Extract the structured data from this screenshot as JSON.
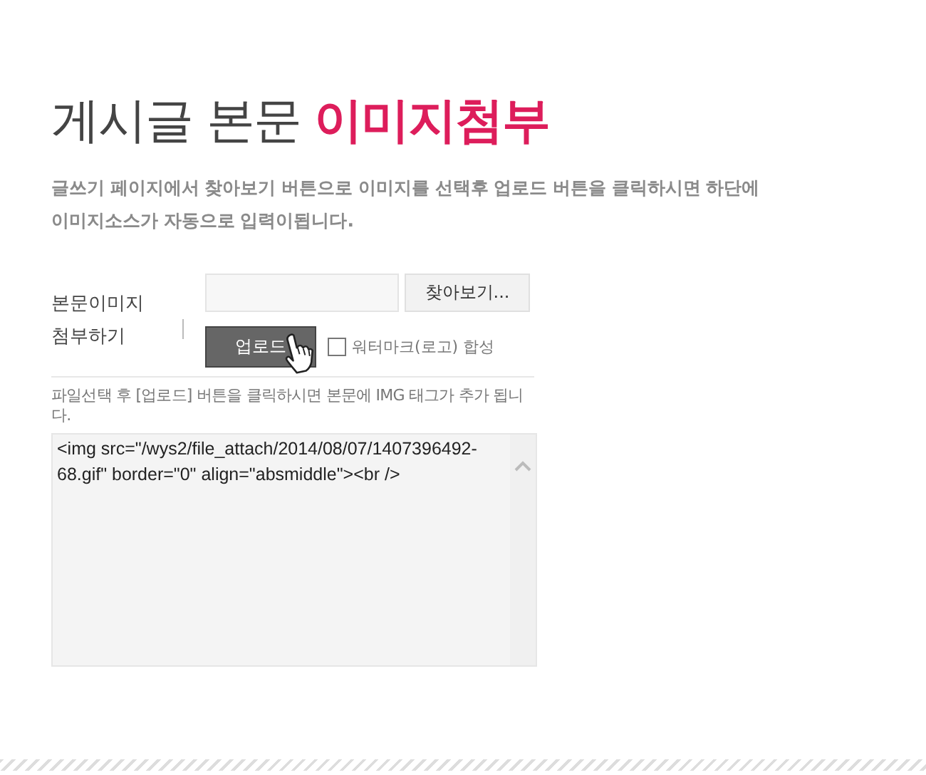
{
  "title": {
    "plain": "게시글 본문",
    "accent": "이미지첨부"
  },
  "description": "글쓰기 페이지에서 찾아보기 버튼으로 이미지를 선택후 업로드 버튼을 클릭하시면 하단에 이미지소스가 자동으로 입력이됩니다.",
  "form": {
    "label": "본문이미지 첨부하기",
    "browse_button": "찾아보기...",
    "upload_button": "업로드",
    "watermark": {
      "label": "워터마크(로고) 합성",
      "checked": false
    }
  },
  "hint": "파일선택 후 [업로드] 버튼을 클릭하시면 본문에 IMG 태그가 추가 됩니다.",
  "code": "<img src=\"/wys2/file_attach/2014/08/07/1407396492-68.gif\" border=\"0\" align=\"absmiddle\"><br />"
}
